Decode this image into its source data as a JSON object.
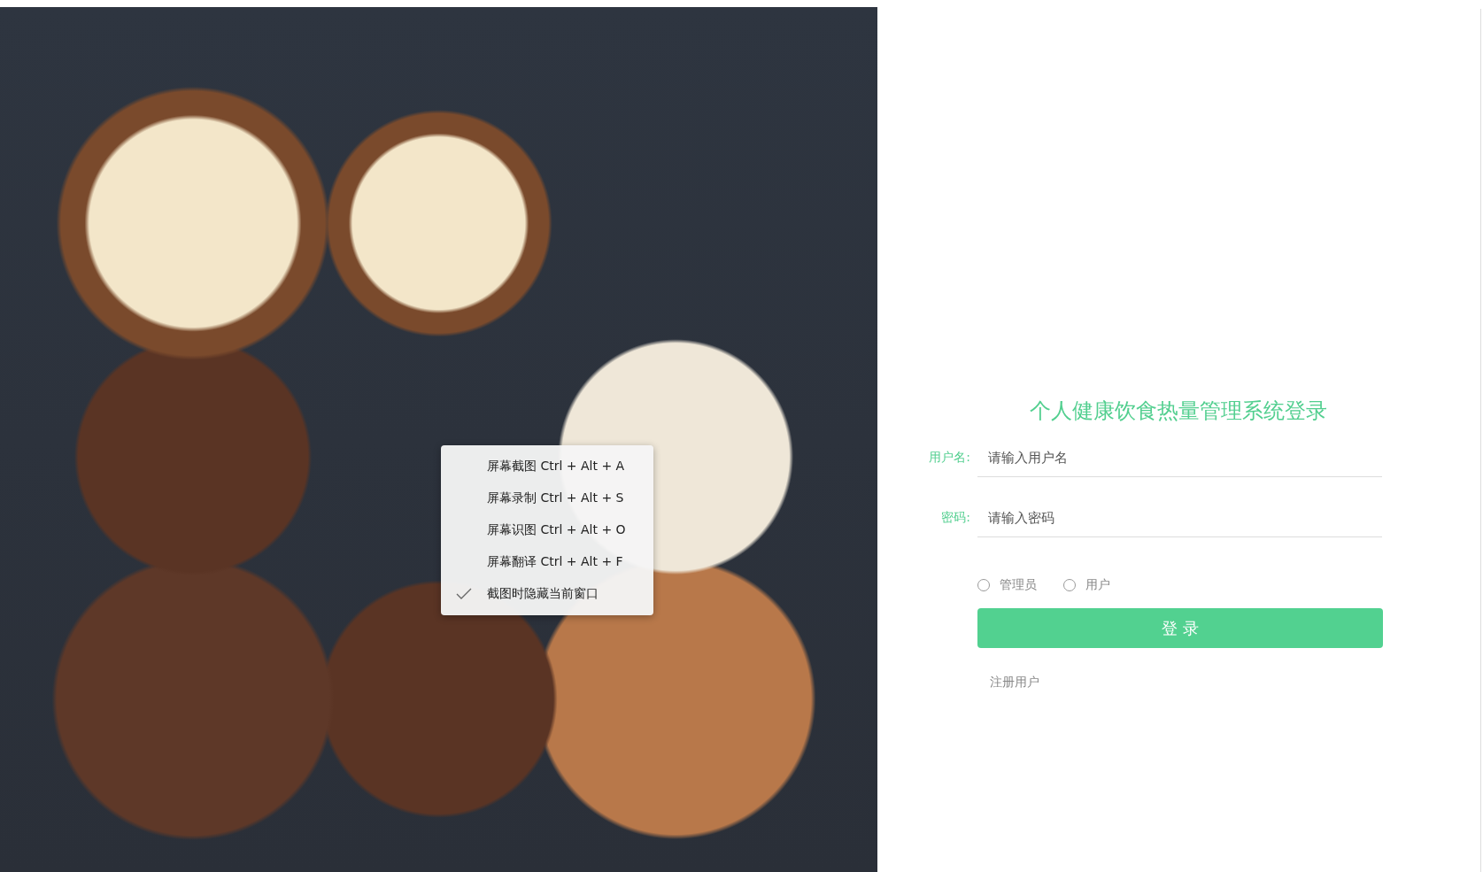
{
  "login": {
    "title": "个人健康饮食热量管理系统登录",
    "fields": [
      {
        "label": "用户名:",
        "placeholder": "请输入用户名"
      },
      {
        "label": "密码:",
        "placeholder": "请输入密码"
      }
    ],
    "roles": [
      {
        "label": "管理员",
        "selected": false
      },
      {
        "label": "用户",
        "selected": false
      }
    ],
    "submit": "登 录",
    "register_link": "注册用户"
  },
  "context_menu": [
    {
      "label": "屏幕截图 Ctrl + Alt + A",
      "checked": false
    },
    {
      "label": "屏幕录制 Ctrl + Alt + S",
      "checked": false
    },
    {
      "label": "屏幕识图 Ctrl + Alt + O",
      "checked": false
    },
    {
      "label": "屏幕翻译 Ctrl + Alt + F",
      "checked": false
    },
    {
      "label": "截图时隐藏当前窗口",
      "checked": true
    }
  ]
}
